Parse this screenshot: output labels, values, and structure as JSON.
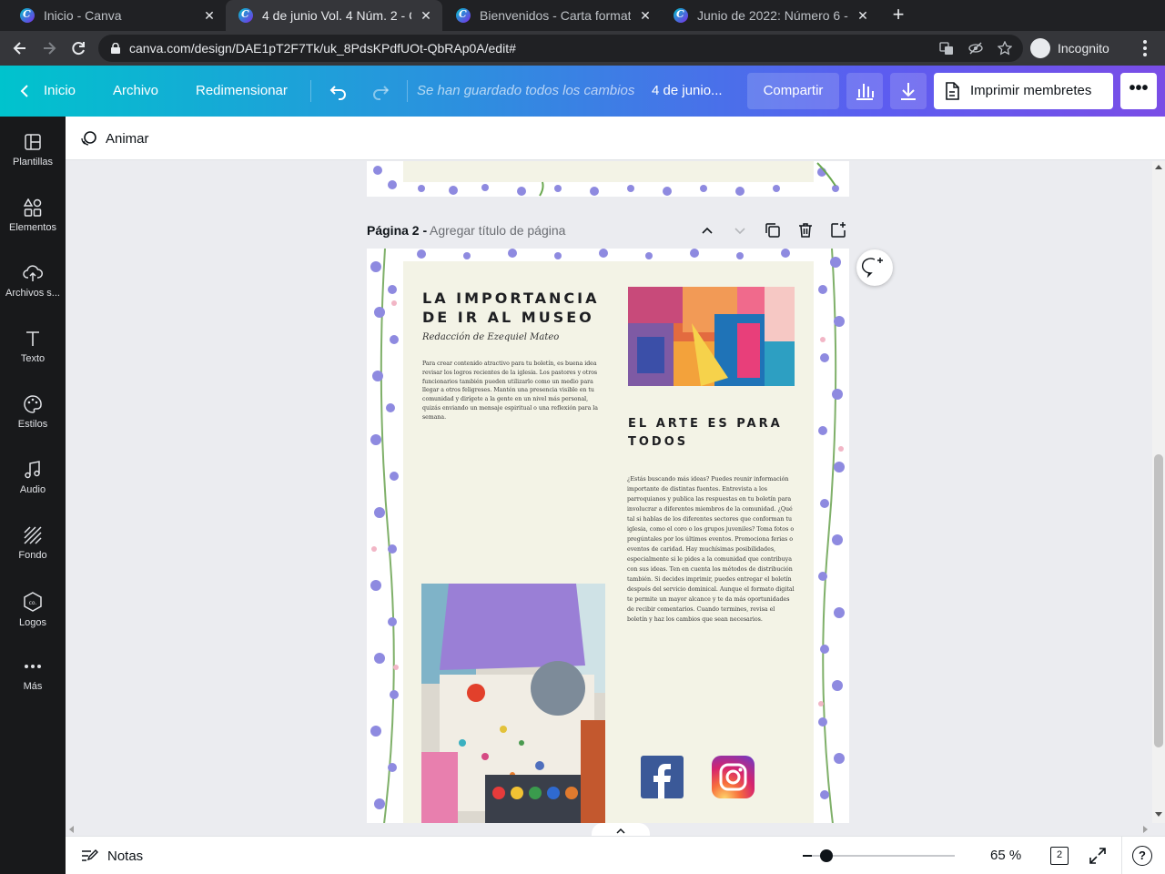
{
  "browser": {
    "tabs": [
      {
        "title": "Inicio - Canva",
        "active": false
      },
      {
        "title": "4 de junio Vol. 4 Núm. 2 - C",
        "active": true
      },
      {
        "title": "Bienvenidos - Carta format",
        "active": false
      },
      {
        "title": "Junio de 2022: Número 6 - ",
        "active": false
      }
    ],
    "close_glyph": "✕",
    "new_tab_glyph": "+",
    "url": "canva.com/design/DAE1pT2F7Tk/uk_8PdsKPdfUOt-QbRAp0A/edit#",
    "incognito_label": "Incognito"
  },
  "header": {
    "home_label": "Inicio",
    "file_label": "Archivo",
    "resize_label": "Redimensionar",
    "saved_status": "Se han guardado todos los cambios",
    "doc_title": "4 de junio...",
    "share_label": "Compartir",
    "print_label": "Imprimir membretes",
    "more_glyph": "•••"
  },
  "sidebar": {
    "items": [
      {
        "label": "Plantillas",
        "icon": "templates-icon"
      },
      {
        "label": "Elementos",
        "icon": "elements-icon"
      },
      {
        "label": "Archivos s...",
        "icon": "uploads-icon"
      },
      {
        "label": "Texto",
        "icon": "text-icon"
      },
      {
        "label": "Estilos",
        "icon": "palette-icon"
      },
      {
        "label": "Audio",
        "icon": "music-icon"
      },
      {
        "label": "Fondo",
        "icon": "background-icon"
      },
      {
        "label": "Logos",
        "icon": "logo-icon"
      },
      {
        "label": "Más",
        "icon": "more-icon"
      }
    ]
  },
  "toolbar": {
    "animate_label": "Animar"
  },
  "page": {
    "label": "Página 2 -",
    "title_placeholder": "Agregar título de página"
  },
  "design": {
    "title1": "LA IMPORTANCIA DE IR AL MUSEO",
    "byline": "Redacción de Ezequiel Mateo",
    "body1": "Para crear contenido atractivo para tu boletín, es buena idea revisar los logros recientes de la iglesia. Los pastores y otros funcionarios también pueden utilizarlo como un medio para llegar a otros feligreses. Mantén una presencia visible en tu comunidad y dirígete a la gente en un nivel más personal, quizás enviando un mensaje espiritual o una reflexión para la semana.",
    "title2": "EL ARTE ES PARA TODOS",
    "body2": "¿Estás buscando más ideas? Puedes reunir información importante de distintas fuentes. Entrevista a los parroquianos y publica las respuestas en tu boletín para involucrar a diferentes miembros de la comunidad. ¿Qué tal si hablas de los diferentes sectores que conforman tu iglesia, como el coro o los grupos juveniles? Toma fotos o pregúntales por los últimos eventos. Promociona ferias o eventos de caridad. Hay muchísimas posibilidades, especialmente si le pides a la comunidad que contribuya con sus ideas. Ten en cuenta los métodos de distribución también. Si decides imprimir, puedes entregar el boletín después del servicio dominical. Aunque el formato digital te permite un mayor alcance y te da más oportunidades de recibir comentarios. Cuando termines, revisa el boletín y haz los cambios que sean necesarios."
  },
  "footer": {
    "notes_label": "Notas",
    "zoom_percent": "65 %",
    "zoom_fraction": 0.1,
    "page_count": "2"
  },
  "colors": {
    "header_start": "#00c3cd",
    "header_end": "#7a4de6",
    "sidebar_bg": "#18191b",
    "panel_bg": "#f3f3e6"
  }
}
